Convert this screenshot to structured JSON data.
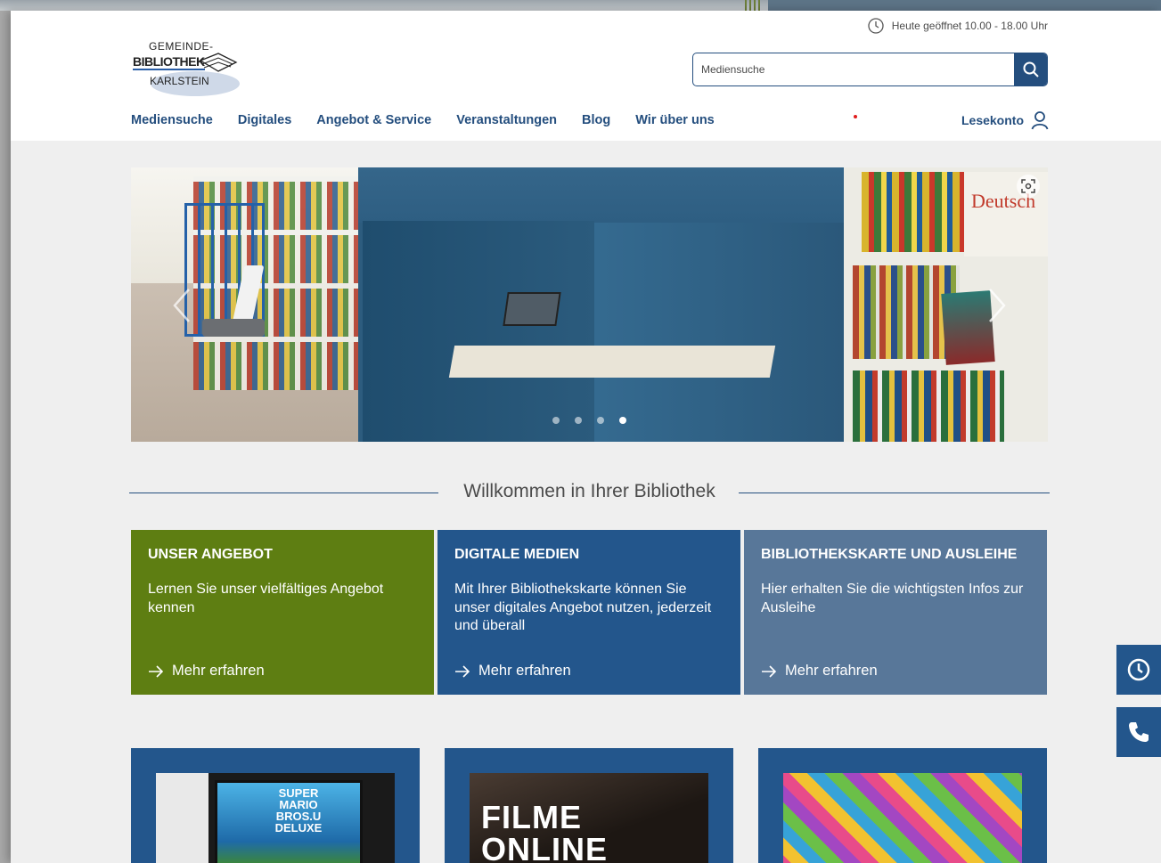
{
  "header": {
    "hours_text": "Heute geöffnet 10.00 - 18.00 Uhr",
    "logo": {
      "line1": "GEMEINDE-",
      "line2": "BIBLIOTHEK",
      "line3": "KARLSTEIN"
    },
    "search": {
      "placeholder": "Mediensuche"
    },
    "nav": [
      "Mediensuche",
      "Digitales",
      "Angebot & Service",
      "Veranstaltungen",
      "Blog",
      "Wir über uns"
    ],
    "account_label": "Lesekonto"
  },
  "slider": {
    "slide_count": 4,
    "active_index": 3
  },
  "welcome_heading": "Willkommen in Ihrer Bibliothek",
  "tiles": [
    {
      "title": "UNSER ANGEBOT",
      "text": "Lernen Sie unser vielfältiges Angebot kennen",
      "more": "Mehr erfahren",
      "color": "#5e7e12"
    },
    {
      "title": "DIGITALE MEDIEN",
      "text": "Mit Ihrer Bibliothekskarte können Sie unser digitales Angebot nutzen, jederzeit und überall",
      "more": "Mehr erfahren",
      "color": "#23568c"
    },
    {
      "title": "BIBLIOTHEKSKARTE UND AUSLEIHE",
      "text": "Hier erhalten Sie die wichtigsten Infos zur Ausleihe",
      "more": "Mehr erfahren",
      "color": "#587799"
    }
  ],
  "cards": [
    {
      "image_text": "SUPER MARIO BROS.U DELUXE"
    },
    {
      "image_text": "FILME ONLINE"
    },
    {
      "image_text": ""
    }
  ],
  "colors": {
    "primary": "#244e7e",
    "green": "#5e7e12",
    "slate": "#587799",
    "background": "#efefef"
  },
  "icons": {
    "hours": "clock-icon",
    "search": "search-icon",
    "account": "user-icon",
    "side_hours": "clock-icon",
    "side_phone": "phone-icon"
  }
}
